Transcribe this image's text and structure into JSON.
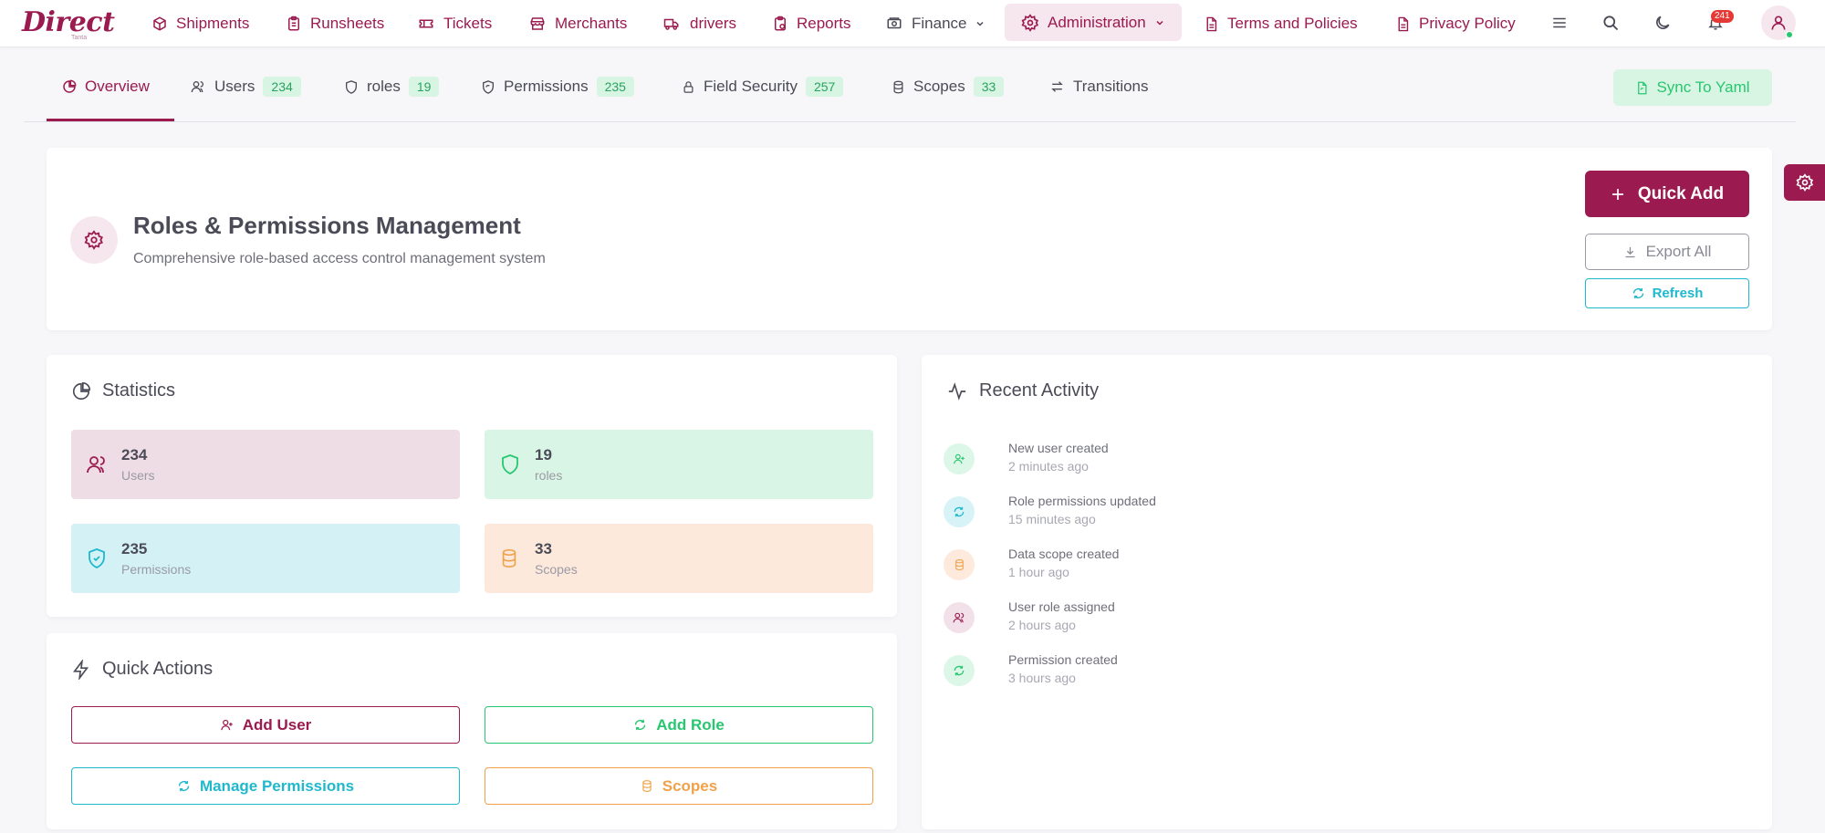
{
  "brand": {
    "logo_text": "Direct",
    "logo_sub": "Tanta"
  },
  "nav": {
    "items": [
      {
        "label": "Shipments",
        "icon": "box-icon"
      },
      {
        "label": "Runsheets",
        "icon": "clipboard-icon"
      },
      {
        "label": "Tickets",
        "icon": "ticket-icon"
      },
      {
        "label": "Merchants",
        "icon": "store-icon"
      },
      {
        "label": "drivers",
        "icon": "truck-icon"
      },
      {
        "label": "Reports",
        "icon": "report-icon"
      },
      {
        "label": "Finance",
        "icon": "cash-icon"
      },
      {
        "label": "Administration",
        "icon": "gear-icon"
      },
      {
        "label": "Terms and Policies",
        "icon": "document-icon"
      },
      {
        "label": "Privacy Policy",
        "icon": "document-icon"
      }
    ],
    "notifications_count": "241"
  },
  "tabs": [
    {
      "label": "Overview",
      "icon": "chart-pie-icon"
    },
    {
      "label": "Users",
      "count": "234",
      "icon": "users-icon"
    },
    {
      "label": "roles",
      "count": "19",
      "icon": "shield-icon"
    },
    {
      "label": "Permissions",
      "count": "235",
      "icon": "shield-refresh-icon"
    },
    {
      "label": "Field Security",
      "count": "257",
      "icon": "lock-icon"
    },
    {
      "label": "Scopes",
      "count": "33",
      "icon": "database-icon"
    },
    {
      "label": "Transitions",
      "icon": "arrows-icon"
    }
  ],
  "sync_label": "Sync To Yaml",
  "header": {
    "title": "Roles & Permissions Management",
    "subtitle": "Comprehensive role-based access control management system",
    "quick_add": "Quick Add",
    "export_all": "Export All",
    "refresh": "Refresh"
  },
  "statistics": {
    "title": "Statistics",
    "tiles": [
      {
        "value": "234",
        "label": "Users",
        "bg": "#efdde5",
        "color": "#9b1a4f"
      },
      {
        "value": "19",
        "label": "roles",
        "bg": "#d9f5e5",
        "color": "#28c76f"
      },
      {
        "value": "235",
        "label": "Permissions",
        "bg": "#d4f2f6",
        "color": "#1fb8cc"
      },
      {
        "value": "33",
        "label": "Scopes",
        "bg": "#fde9dc",
        "color": "#f0a24a"
      }
    ]
  },
  "quick_actions": {
    "title": "Quick Actions",
    "buttons": [
      {
        "label": "Add User",
        "color": "#9b1a4f"
      },
      {
        "label": "Add Role",
        "color": "#28c76f"
      },
      {
        "label": "Manage Permissions",
        "color": "#1fb8cc"
      },
      {
        "label": "Scopes",
        "color": "#f0a24a"
      }
    ]
  },
  "recent_activity": {
    "title": "Recent Activity",
    "items": [
      {
        "title": "New user created",
        "time": "2 minutes ago",
        "color": "#28c76f",
        "bg": "#dcf6e7"
      },
      {
        "title": "Role permissions updated",
        "time": "15 minutes ago",
        "color": "#1fb8cc",
        "bg": "#d8f3f7"
      },
      {
        "title": "Data scope created",
        "time": "1 hour ago",
        "color": "#f0a24a",
        "bg": "#fdeadc"
      },
      {
        "title": "User role assigned",
        "time": "2 hours ago",
        "color": "#9b1a4f",
        "bg": "#f3e1e9"
      },
      {
        "title": "Permission created",
        "time": "3 hours ago",
        "color": "#28c76f",
        "bg": "#dcf6e7"
      }
    ]
  }
}
